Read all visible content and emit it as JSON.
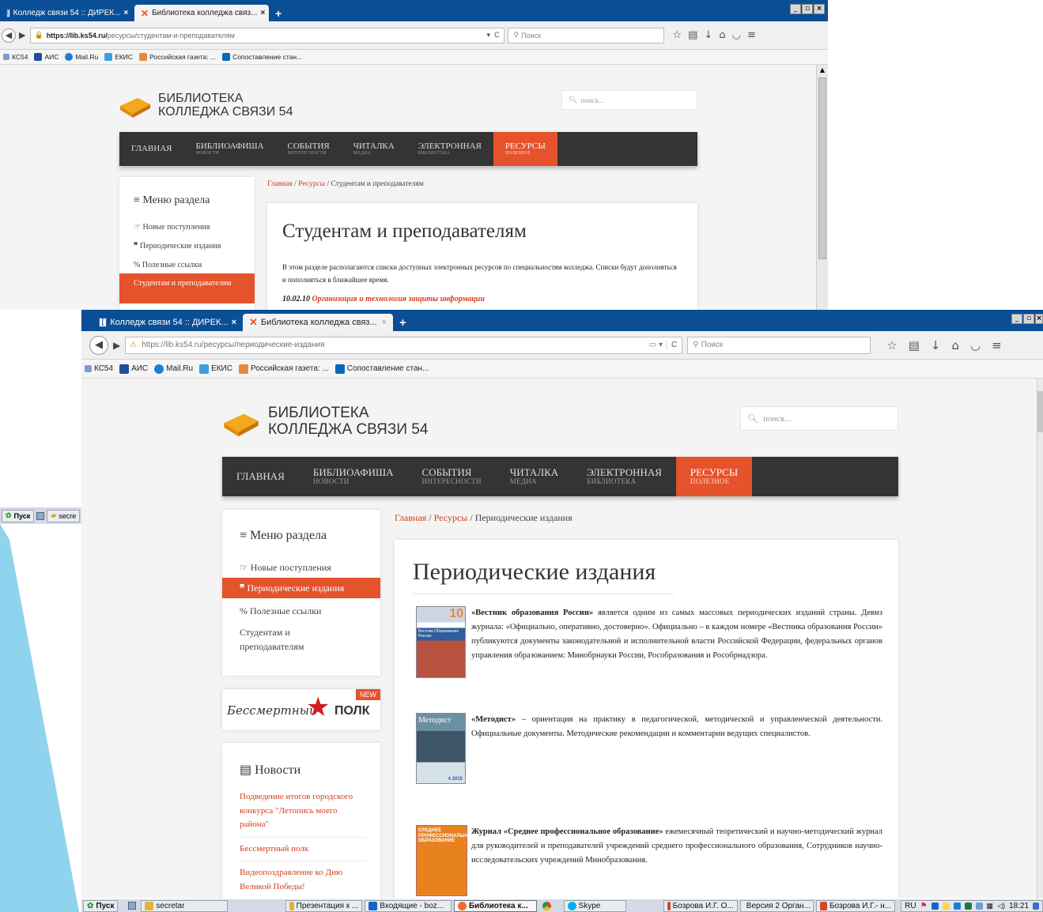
{
  "back_window": {
    "tabs": [
      {
        "title": "Колледж связи 54 :: ДИРЕК...",
        "close": "×"
      },
      {
        "title": "Библиотека колледжа связ...",
        "close": "×"
      }
    ],
    "new_tab": "+",
    "win_controls": [
      "_",
      "▫",
      "×"
    ],
    "url_host": "https://lib.ks54.ru/",
    "url_path": "ресурсы/студентам-и-преподавателям",
    "search_placeholder": "Поиск",
    "bookmarks": [
      "КС54",
      "АИС",
      "Mail.Ru",
      "ЕКИС",
      "Российская газета: ...",
      "Сопоставление стан..."
    ],
    "site": {
      "logo_line1": "БИБЛИОТЕКА",
      "logo_line2": "КОЛЛЕДЖА СВЯЗИ 54",
      "search_placeholder": "поиск...",
      "nav": [
        {
          "label": "ГЛАВНАЯ",
          "sub": ""
        },
        {
          "label": "БИБЛИОАФИША",
          "sub": "НОВОСТИ"
        },
        {
          "label": "СОБЫТИЯ",
          "sub": "ИНТЕРЕСНОСТИ"
        },
        {
          "label": "ЧИТАЛКА",
          "sub": "МЕДИА"
        },
        {
          "label": "ЭЛЕКТРОННАЯ",
          "sub": "БИБЛИОТЕКА"
        },
        {
          "label": "РЕСУРСЫ",
          "sub": "ПОЛЕЗНОЕ"
        }
      ],
      "crumb_home": "Главная",
      "crumb_res": "Ресурсы",
      "crumb_sep": "/",
      "crumb_current": "Студентам и преподавателям",
      "menu_title": "Меню раздела",
      "menu": [
        "Новые поступления",
        "Периодические издания",
        "Полезные ссылки",
        "Студентам и преподавателям"
      ],
      "heading": "Студентам и преподавателям",
      "text": "В этом разделе располагаются списки доступных электронных ресурсов по специальностям колледжа. Списки будут дополняться и пополняться в ближайшее время.",
      "spec_code": "10.02.10",
      "spec_name": "Организация и технология защиты информации"
    }
  },
  "front_window": {
    "tabs": [
      {
        "title": "Колледж связи 54 :: ДИРЕК...",
        "close": "×"
      },
      {
        "title": "Библиотека колледжа связ...",
        "close": "×"
      }
    ],
    "new_tab": "+",
    "win_controls": [
      "_",
      "▫",
      "×"
    ],
    "url_host": "https://lib.ks54.ru/",
    "url_path": "ресурсы/периодические-издания",
    "search_placeholder": "Поиск",
    "bookmarks": [
      "КС54",
      "АИС",
      "Mail.Ru",
      "ЕКИС",
      "Российская газета: ...",
      "Сопоставление стан..."
    ],
    "site": {
      "logo_line1": "БИБЛИОТЕКА",
      "logo_line2": "КОЛЛЕДЖА СВЯЗИ 54",
      "search_placeholder": "поиск...",
      "nav": [
        {
          "label": "ГЛАВНАЯ",
          "sub": ""
        },
        {
          "label": "БИБЛИОАФИША",
          "sub": "НОВОСТИ"
        },
        {
          "label": "СОБЫТИЯ",
          "sub": "ИНТЕРЕСНОСТИ"
        },
        {
          "label": "ЧИТАЛКА",
          "sub": "МЕДИА"
        },
        {
          "label": "ЭЛЕКТРОННАЯ",
          "sub": "БИБЛИОТЕКА"
        },
        {
          "label": "РЕСУРСЫ",
          "sub": "ПОЛЕЗНОЕ"
        }
      ],
      "crumb_home": "Главная",
      "crumb_res": "Ресурсы",
      "crumb_sep": "/",
      "crumb_current": "Периодические издания",
      "menu_title": "Меню раздела",
      "menu": [
        "Новые поступления",
        "Периодические издания",
        "Полезные ссылки",
        "Студентам и преподавателям"
      ],
      "banner_badge": "NEW",
      "banner_script": "Бессмертный",
      "banner_word": "ПОЛК",
      "news_title": "Новости",
      "news": [
        "Подведение итогов городского конкурса \"Летопись моего района\"",
        "Бессмертный полк",
        "Видеопоздравление ко Дню Великой Победы!"
      ],
      "heading": "Периодические издания",
      "entries": [
        {
          "bold": "«Вестник образования России»",
          "text": " является одним из самых массовых периодических изданий страны. Девиз журнала: «Официально, оперативно, достоверно». Официально – в каждом номере «Вестника образования России» публикуются документы законодательной и исполнительной власти Российской Федерации, федеральных органов управления образованием: Минобрнауки России, Рособразования и Рособрнадзора.",
          "cover_label": "Вестник Образования России",
          "cover_num": "10"
        },
        {
          "bold": "«Методист»",
          "text": " – ориентация на практику в педагогической, методической и управленческой деятельности. Официальные документы. Методические рекомендации и комментарии ведущих специалистов.",
          "cover_label": "Методист",
          "cover_num": "4 2015"
        },
        {
          "bold": "Журнал «Среднее профессиональное образование»",
          "text": " ежемесячный теоретический и научно-методический журнал для руководителей и преподавателей учреждений среднего профессионального образования, Сотрудников научно-исследовательских учреждений Минобразования.",
          "cover_label": "СРЕДНЕЕ ПРОФЕССИОНАЛЬНОЕ ОБРАЗОВАНИЕ",
          "cover_num": ""
        }
      ]
    }
  },
  "left_taskbar": {
    "start": "Пуск",
    "item": "secre"
  },
  "taskbar": {
    "start": "Пуск",
    "buttons": [
      "secretar",
      "Презентация к ...",
      "Входящие - boz...",
      "Библиотека к...",
      "",
      "Skype",
      "Бозрова И.Г. О...",
      "Версия 2 Орган...",
      "Бозрова И.Г.- н..."
    ],
    "lang": "RU",
    "clock": "18:21"
  },
  "colors": {
    "accent": "#e4532c",
    "nav_bg": "#343434",
    "tabstrip": "#0a4f96",
    "desktop_cyan": "#8fd3ee"
  }
}
